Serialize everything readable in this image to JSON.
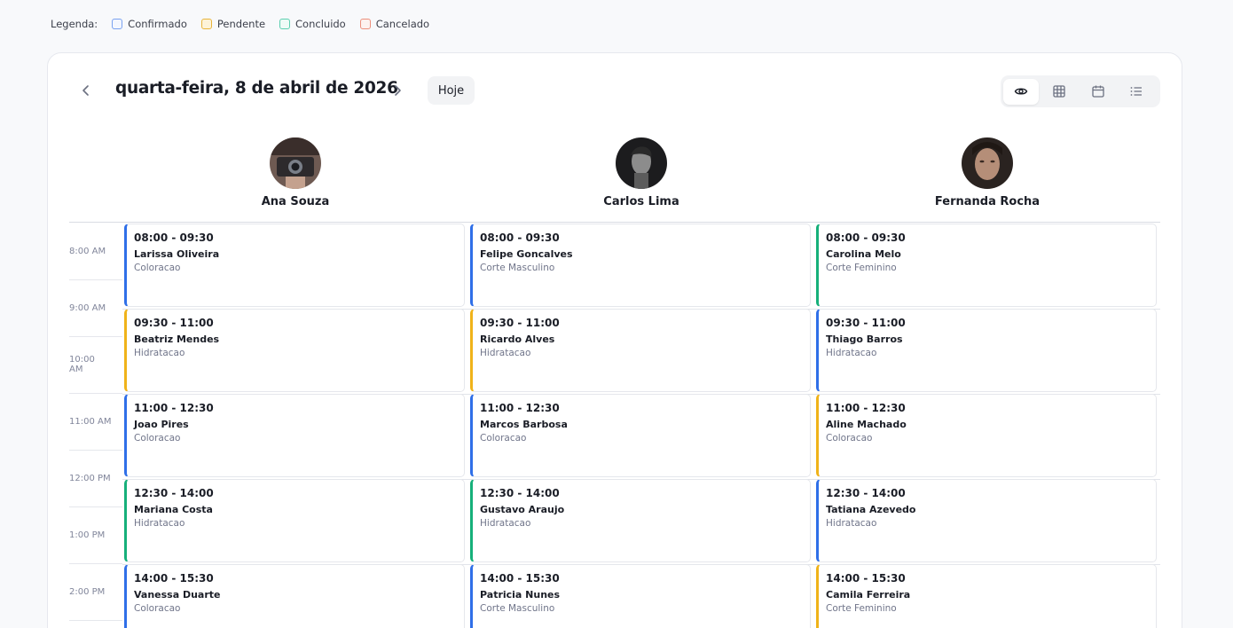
{
  "legend": {
    "title": "Legenda:",
    "items": [
      {
        "label": "Confirmado",
        "color": "#7aa2f0"
      },
      {
        "label": "Pendente",
        "color": "#e8b43a"
      },
      {
        "label": "Concluido",
        "color": "#5ccfb0"
      },
      {
        "label": "Cancelado",
        "color": "#ec8f7c"
      }
    ]
  },
  "header": {
    "date_title": "quarta-feira, 8 de abril de 2026",
    "today_label": "Hoje",
    "prev_icon": "chevron-left-icon",
    "next_icon": "chevron-right-icon",
    "views": [
      {
        "icon": "eye-icon",
        "active": true
      },
      {
        "icon": "grid-icon",
        "active": false
      },
      {
        "icon": "calendar-icon",
        "active": false
      },
      {
        "icon": "list-icon",
        "active": false
      }
    ]
  },
  "status_colors": {
    "confirmado": "#2f6fe8",
    "pendente": "#f0b31a",
    "concluido": "#16b07a"
  },
  "times": [
    "8:00 AM",
    "9:00 AM",
    "10:00 AM",
    "11:00 AM",
    "12:00 PM",
    "1:00 PM",
    "2:00 PM"
  ],
  "staff": [
    {
      "name": "Ana Souza",
      "appointments": [
        {
          "time": "08:00 - 09:30",
          "client": "Larissa Oliveira",
          "service": "Coloracao",
          "status": "confirmado"
        },
        {
          "time": "09:30 - 11:00",
          "client": "Beatriz Mendes",
          "service": "Hidratacao",
          "status": "pendente"
        },
        {
          "time": "11:00 - 12:30",
          "client": "Joao Pires",
          "service": "Coloracao",
          "status": "confirmado"
        },
        {
          "time": "12:30 - 14:00",
          "client": "Mariana Costa",
          "service": "Hidratacao",
          "status": "concluido"
        },
        {
          "time": "14:00 - 15:30",
          "client": "Vanessa Duarte",
          "service": "Coloracao",
          "status": "confirmado"
        }
      ]
    },
    {
      "name": "Carlos Lima",
      "appointments": [
        {
          "time": "08:00 - 09:30",
          "client": "Felipe Goncalves",
          "service": "Corte Masculino",
          "status": "confirmado"
        },
        {
          "time": "09:30 - 11:00",
          "client": "Ricardo Alves",
          "service": "Hidratacao",
          "status": "pendente"
        },
        {
          "time": "11:00 - 12:30",
          "client": "Marcos Barbosa",
          "service": "Coloracao",
          "status": "confirmado"
        },
        {
          "time": "12:30 - 14:00",
          "client": "Gustavo Araujo",
          "service": "Hidratacao",
          "status": "concluido"
        },
        {
          "time": "14:00 - 15:30",
          "client": "Patricia Nunes",
          "service": "Corte Masculino",
          "status": "confirmado"
        }
      ]
    },
    {
      "name": "Fernanda Rocha",
      "appointments": [
        {
          "time": "08:00 - 09:30",
          "client": "Carolina Melo",
          "service": "Corte Feminino",
          "status": "concluido"
        },
        {
          "time": "09:30 - 11:00",
          "client": "Thiago Barros",
          "service": "Hidratacao",
          "status": "confirmado"
        },
        {
          "time": "11:00 - 12:30",
          "client": "Aline Machado",
          "service": "Coloracao",
          "status": "pendente"
        },
        {
          "time": "12:30 - 14:00",
          "client": "Tatiana Azevedo",
          "service": "Hidratacao",
          "status": "confirmado"
        },
        {
          "time": "14:00 - 15:30",
          "client": "Camila Ferreira",
          "service": "Corte Feminino",
          "status": "pendente"
        }
      ]
    }
  ]
}
